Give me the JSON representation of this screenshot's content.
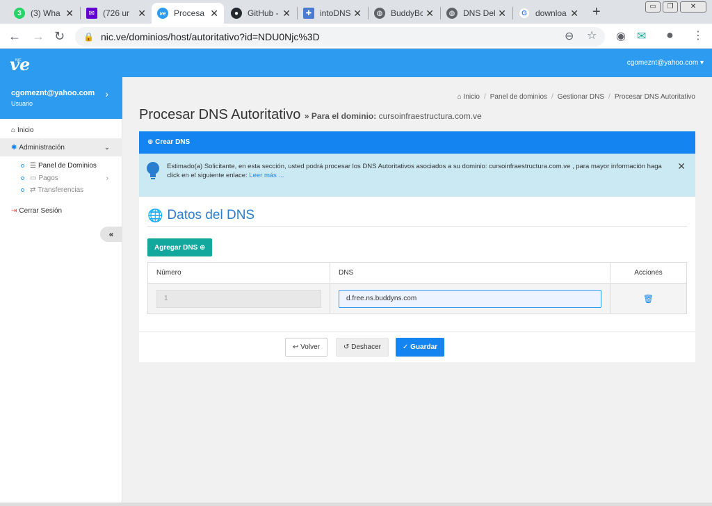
{
  "browser": {
    "tabs": [
      {
        "title": "(3) Wha",
        "favicon_text": "3",
        "favicon_color": "#25d366"
      },
      {
        "title": "(726 ur",
        "favicon_text": "✉",
        "favicon_color": "#6001d2"
      },
      {
        "title": "Procesa",
        "favicon_text": "ve",
        "favicon_color": "#2d9bf0"
      },
      {
        "title": "GitHub -",
        "favicon_text": "●",
        "favicon_color": "#24292e"
      },
      {
        "title": "intoDNS",
        "favicon_text": "✚",
        "favicon_color": "#4a7bd0"
      },
      {
        "title": "BuddyBc",
        "favicon_text": "◍",
        "favicon_color": "#5f6368"
      },
      {
        "title": "DNS Del",
        "favicon_text": "◍",
        "favicon_color": "#5f6368"
      },
      {
        "title": "downloa",
        "favicon_text": "G",
        "favicon_color": "#4285f4"
      }
    ],
    "new_tab": "+",
    "url": "nic.ve/dominios/host/autoritativo?id=NDU0Njc%3D"
  },
  "header": {
    "logo": "ve",
    "logo_sup": "NIC",
    "user_email": "cgomeznt@yahoo.com ▾"
  },
  "sidebar": {
    "user_email": "cgomeznt@yahoo.com",
    "user_role": "Usuario",
    "items": {
      "inicio": "Inicio",
      "administracion": "Administración",
      "panel_dominios": "Panel de Dominios",
      "pagos": "Pagos",
      "transferencias": "Transferencias",
      "cerrar_sesion": "Cerrar Sesión"
    },
    "collapse": "«"
  },
  "breadcrumb": [
    "Inicio",
    "Panel de dominios",
    "Gestionar DNS",
    "Procesar DNS Autoritativo"
  ],
  "page": {
    "title": "Procesar DNS Autoritativo",
    "subtitle_prefix": "» Para el dominio:",
    "domain": "cursoinfraestructura.com.ve"
  },
  "panel": {
    "header": "Crear DNS",
    "alert_text": "Estimado(a) Solicitante, en esta sección, usted podrá procesar los DNS Autoritativos asociados a su dominio: cursoinfraestructura.com.ve , para mayor información haga click en el siguiente enlace: ",
    "alert_link": "Leer más ...",
    "section_title": "Datos del DNS",
    "add_button": "Agregar DNS",
    "table": {
      "headers": [
        "Número",
        "DNS",
        "Acciones"
      ],
      "rows": [
        {
          "numero": "1",
          "dns": "d.free.ns.buddyns.com"
        }
      ]
    },
    "buttons": {
      "volver": "Volver",
      "deshacer": "Deshacer",
      "guardar": "Guardar"
    }
  },
  "colors": {
    "primary": "#2d9bf0",
    "panel_header": "#1484f0",
    "alert_bg": "#cbe9f3",
    "add_button": "#13a89e"
  }
}
